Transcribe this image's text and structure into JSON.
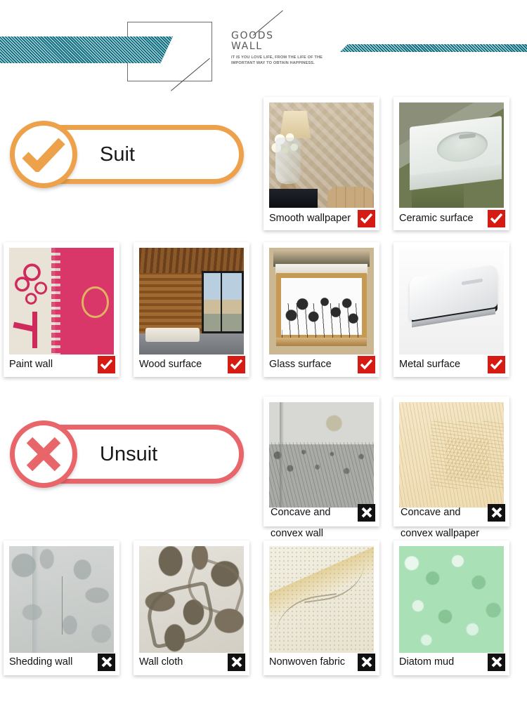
{
  "header": {
    "title_line1": "GOODS",
    "title_line2": "WALL",
    "subtitle": "IT IS YOU LOVE LIFE, FROM THE LIFE OF THE IMPORTANT WAY TO OBTAIN HAPPINESS.",
    "stripe_color": "#0f6f82"
  },
  "suit": {
    "label": "Suit",
    "accent_color": "#eda14a",
    "icon": "check-circle-icon",
    "mark_color": "#d61a14",
    "mark_glyph": "check-icon",
    "items": [
      {
        "label": "Smooth wallpaper",
        "mark": "check-icon"
      },
      {
        "label": "Ceramic surface",
        "mark": "check-icon"
      },
      {
        "label": "Paint wall",
        "mark": "check-icon"
      },
      {
        "label": "Wood surface",
        "mark": "check-icon"
      },
      {
        "label": "Glass surface",
        "mark": "check-icon"
      },
      {
        "label": "Metal surface",
        "mark": "check-icon"
      }
    ]
  },
  "unsuit": {
    "label": "Unsuit",
    "accent_color": "#e8656a",
    "icon": "x-circle-icon",
    "mark_color": "#111111",
    "mark_glyph": "x-icon",
    "items": [
      {
        "label_line1": "Concave and",
        "label_line2": "convex wall",
        "mark": "x-icon"
      },
      {
        "label_line1": "Concave and",
        "label_line2": "convex wallpaper",
        "mark": "x-icon"
      },
      {
        "label": "Shedding wall",
        "mark": "x-icon"
      },
      {
        "label": "Wall cloth",
        "mark": "x-icon"
      },
      {
        "label": "Nonwoven fabric",
        "mark": "x-icon"
      },
      {
        "label": "Diatom mud",
        "mark": "x-icon"
      }
    ]
  }
}
